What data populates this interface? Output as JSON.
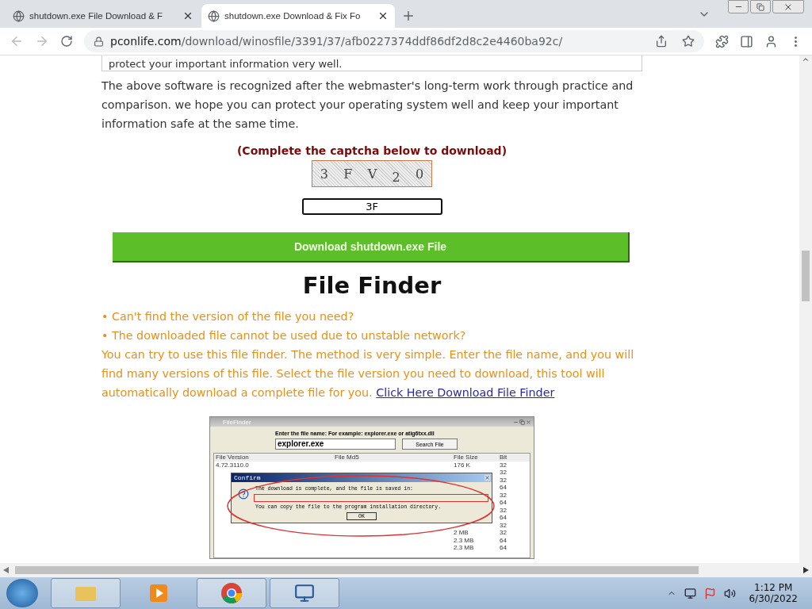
{
  "tabs": [
    {
      "title": "shutdown.exe File Download & F",
      "selected": false
    },
    {
      "title": "shutdown.exe Download & Fix Fo",
      "selected": true
    }
  ],
  "address_bar": {
    "domain": "pconlife.com",
    "path": "/download/winosfile/3391/37/afb0227374ddf86df2d8c2e4460ba92c/"
  },
  "page": {
    "cut_text": "protect your important information very well.",
    "intro": "The above software is recognized after the webmaster's long-term work through practice and comparison. we hope you can protect your operating system well and keep your important information safe at the same time.",
    "captcha_prompt": "(Complete the captcha below to download)",
    "captcha_chars": [
      "3",
      "F",
      "V",
      "2",
      "0"
    ],
    "captcha_input": "3F",
    "download_button": "Download shutdown.exe File",
    "heading": "File Finder",
    "bullets": [
      "• Can't find the version of the file you need?",
      "• The downloaded file cannot be used due to unstable network?"
    ],
    "description": "You can try to use this file finder. The method is very simple. Enter the file name, and you will find many versions of this file. Select the file version you need to download, this tool will automatically download a complete file for you.",
    "link": "Click Here Download File Finder"
  },
  "finder_screenshot": {
    "title": "FileFinder",
    "prompt": "Enter the file name: For example: explorer.exe or atig6txx.dll",
    "input": "explorer.exe",
    "search_button": "Search File",
    "columns": [
      "File Version",
      "File Md5",
      "File Size",
      "Bit"
    ],
    "rows": [
      {
        "version": "4.72.3110.0",
        "size": "176 K",
        "bit": "32"
      },
      {
        "bit": "32"
      },
      {
        "bit": "32"
      },
      {
        "bit": "64"
      },
      {
        "bit": "32"
      },
      {
        "bit": "64"
      },
      {
        "bit": "32"
      },
      {
        "bit": "64"
      },
      {
        "bit": "32"
      },
      {
        "size": "2 MB",
        "bit": "32"
      },
      {
        "size": "2.3 MB",
        "bit": "64"
      },
      {
        "size": "2.3 MB",
        "bit": "64"
      }
    ],
    "dialog": {
      "title": "Confirm",
      "message": "The download is complete, and the file is saved in:",
      "note": "You can copy the file to the program installation directory.",
      "ok": "OK"
    }
  },
  "taskbar": {
    "time": "1:12 PM",
    "date": "6/30/2022"
  }
}
